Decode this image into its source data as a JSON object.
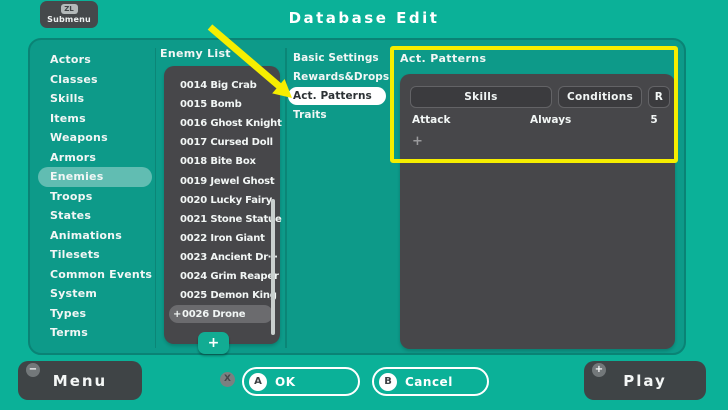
{
  "header": {
    "title": "Database Edit",
    "submenu_key": "ZL",
    "submenu_label": "Submenu"
  },
  "sidebar": {
    "items": [
      "Actors",
      "Classes",
      "Skills",
      "Items",
      "Weapons",
      "Armors",
      "Enemies",
      "Troops",
      "States",
      "Animations",
      "Tilesets",
      "Common Events",
      "System",
      "Types",
      "Terms"
    ],
    "selected": "Enemies"
  },
  "enemy_list": {
    "title": "Enemy List",
    "items": [
      "0014 Big Crab",
      "0015 Bomb",
      "0016 Ghost Knight",
      "0017 Cursed Doll",
      "0018 Bite Box",
      "0019 Jewel Ghost",
      "0020 Lucky Fairy",
      "0021 Stone Statue",
      "0022 Iron Giant",
      "0023 Ancient Dr⋯",
      "0024 Grim Reaper",
      "0025 Demon King",
      "0026 Drone"
    ],
    "selected": "0026 Drone",
    "selected_marker": "+",
    "add_button": "+"
  },
  "sections": {
    "items": [
      "Basic Settings",
      "Rewards&Drops",
      "Act. Patterns",
      "Traits"
    ],
    "selected": "Act. Patterns"
  },
  "detail": {
    "title": "Act. Patterns",
    "columns": {
      "skills": "Skills",
      "conditions": "Conditions",
      "rating": "R"
    },
    "rows": [
      {
        "skill": "Attack",
        "condition": "Always",
        "rating": "5"
      }
    ],
    "add_button": "+"
  },
  "footer": {
    "menu_label": "Menu",
    "menu_badge": "−",
    "x_hint": "X",
    "ok_key": "A",
    "ok_label": "OK",
    "cancel_key": "B",
    "cancel_label": "Cancel",
    "play_label": "Play",
    "play_badge": "+"
  },
  "colors": {
    "background": "#0bb198",
    "window_panel": "#0d9a89",
    "dark_panel": "#47474a",
    "selection_pill": "#6b6b6e",
    "highlight_yellow": "#f6ee00",
    "add_button_teal": "#12ac93"
  }
}
